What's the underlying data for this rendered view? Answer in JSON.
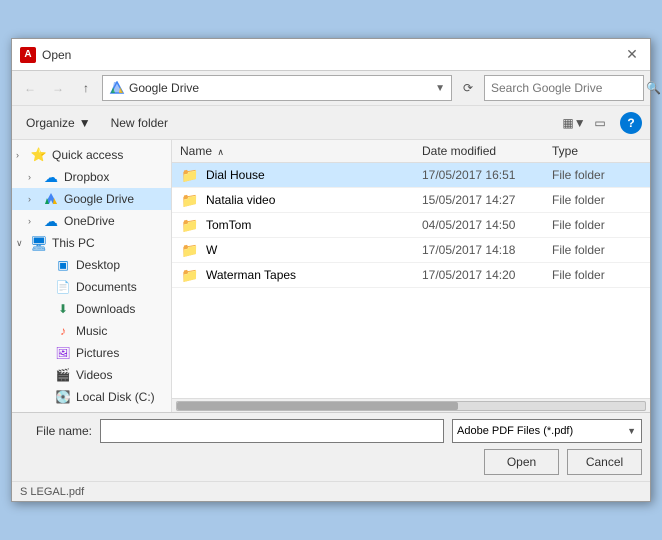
{
  "dialog": {
    "title": "Open",
    "icon": "A"
  },
  "nav": {
    "back_label": "←",
    "forward_label": "→",
    "up_label": "↑",
    "refresh_label": "⟳",
    "address": "Google Drive",
    "search_placeholder": "Search Google Drive"
  },
  "toolbar": {
    "organize_label": "Organize",
    "organize_arrow": "▼",
    "new_folder_label": "New folder",
    "view_icon": "▦",
    "view_down": "▼",
    "pane_icon": "▭",
    "help_label": "?"
  },
  "sidebar": {
    "items": [
      {
        "id": "quick-access",
        "label": "Quick access",
        "arrow": "›",
        "icon": "⭐",
        "icon_type": "quickaccess",
        "indent": 0
      },
      {
        "id": "dropbox",
        "label": "Dropbox",
        "arrow": "›",
        "icon": "☁",
        "icon_type": "dropbox",
        "indent": 1
      },
      {
        "id": "google-drive",
        "label": "Google Drive",
        "arrow": "›",
        "icon": "▲",
        "icon_type": "gdrive",
        "indent": 1,
        "selected": true
      },
      {
        "id": "onedrive",
        "label": "OneDrive",
        "arrow": "›",
        "icon": "☁",
        "icon_type": "onedrive",
        "indent": 1
      },
      {
        "id": "this-pc",
        "label": "This PC",
        "arrow": "∨",
        "icon": "🖥",
        "icon_type": "thispc",
        "indent": 0
      },
      {
        "id": "desktop",
        "label": "Desktop",
        "arrow": "",
        "icon": "▣",
        "icon_type": "desktop",
        "indent": 2
      },
      {
        "id": "documents",
        "label": "Documents",
        "arrow": "",
        "icon": "📄",
        "icon_type": "docs",
        "indent": 2
      },
      {
        "id": "downloads",
        "label": "Downloads",
        "arrow": "",
        "icon": "⬇",
        "icon_type": "download",
        "indent": 2
      },
      {
        "id": "music",
        "label": "Music",
        "arrow": "",
        "icon": "♪",
        "icon_type": "music",
        "indent": 2
      },
      {
        "id": "pictures",
        "label": "Pictures",
        "arrow": "",
        "icon": "🖼",
        "icon_type": "pics",
        "indent": 2
      },
      {
        "id": "videos",
        "label": "Videos",
        "arrow": "",
        "icon": "🎬",
        "icon_type": "videos",
        "indent": 2
      },
      {
        "id": "local-disk",
        "label": "Local Disk (C:)",
        "arrow": "",
        "icon": "💽",
        "icon_type": "localdisk",
        "indent": 2
      }
    ]
  },
  "file_list": {
    "columns": [
      {
        "id": "name",
        "label": "Name",
        "sort_arrow": "∧"
      },
      {
        "id": "date",
        "label": "Date modified"
      },
      {
        "id": "type",
        "label": "Type"
      }
    ],
    "rows": [
      {
        "name": "Dial House",
        "date": "17/05/2017 16:51",
        "type": "File folder",
        "selected": true
      },
      {
        "name": "Natalia video",
        "date": "15/05/2017 14:27",
        "type": "File folder"
      },
      {
        "name": "TomTom",
        "date": "04/05/2017 14:50",
        "type": "File folder"
      },
      {
        "name": "W",
        "date": "17/05/2017 14:18",
        "type": "File folder"
      },
      {
        "name": "Waterman Tapes",
        "date": "17/05/2017 14:20",
        "type": "File folder"
      }
    ]
  },
  "bottom": {
    "filename_label": "File name:",
    "filename_value": "",
    "filetype_value": "Adobe PDF Files (*.pdf)",
    "open_label": "Open",
    "cancel_label": "Cancel"
  },
  "status_bar": {
    "text": "S LEGAL.pdf"
  }
}
